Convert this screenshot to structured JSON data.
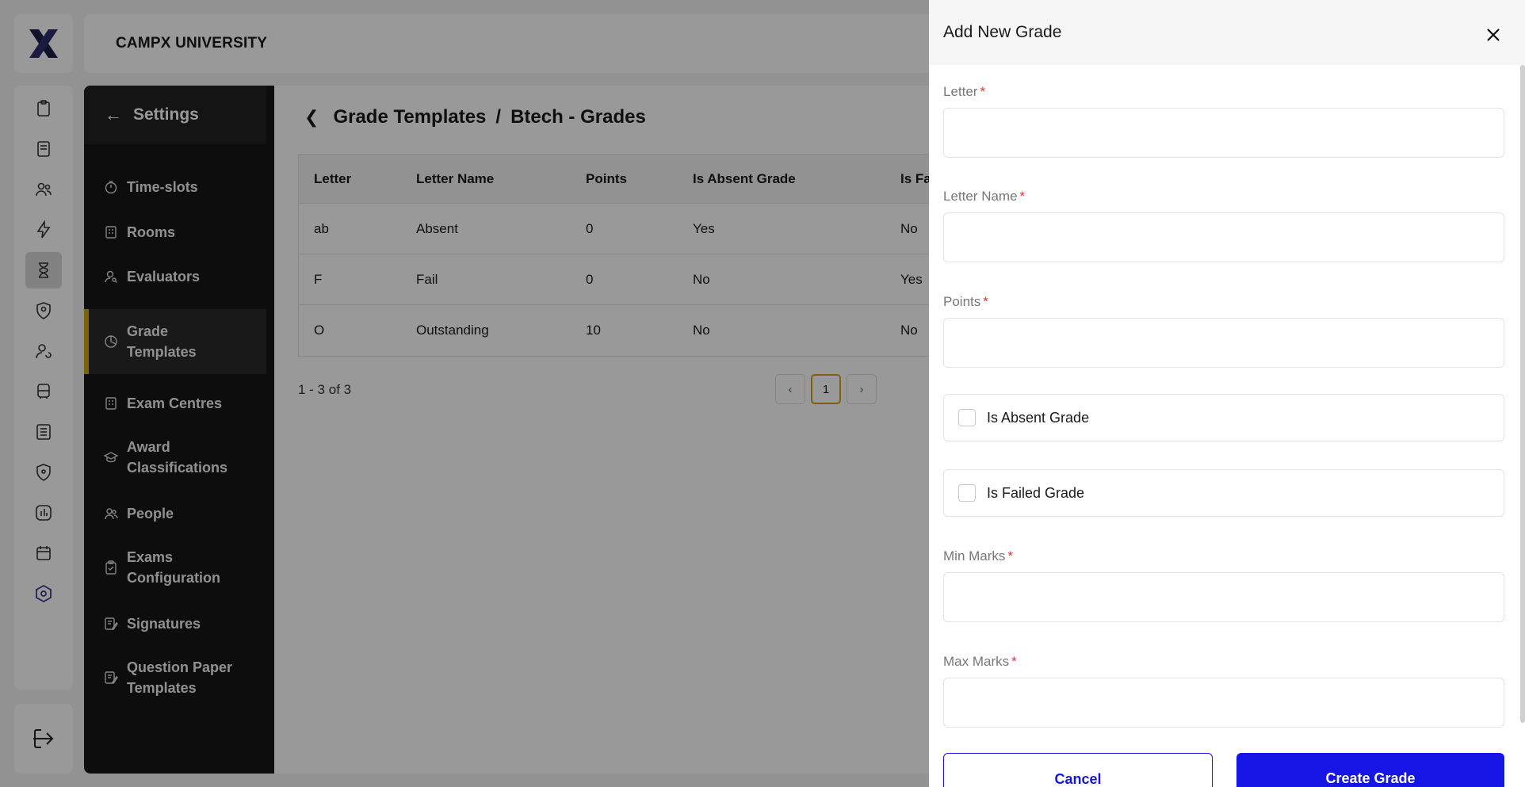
{
  "header": {
    "title": "CAMPX UNIVERSITY"
  },
  "rail": {
    "icons": [
      "clipboard-icon",
      "notebook-icon",
      "users-icon",
      "lightning-icon",
      "hourglass-icon",
      "shield-user-icon",
      "user-refresh-icon",
      "bus-icon",
      "list-icon",
      "location-shield-icon",
      "chart-icon",
      "calendar-icon",
      "settings-hex-icon"
    ],
    "active": "hourglass-icon",
    "logout_icon": "logout-icon"
  },
  "settings": {
    "title": "Settings",
    "items": [
      {
        "label": "Time-slots",
        "icon": "stopwatch-icon"
      },
      {
        "label": "Rooms",
        "icon": "building-icon"
      },
      {
        "label": "Evaluators",
        "icon": "user-search-icon"
      },
      {
        "label": "Grade Templates",
        "icon": "grade-icon",
        "active": true
      },
      {
        "label": "Exam Centres",
        "icon": "building-icon"
      },
      {
        "label": "Award Classifications",
        "icon": "graduation-cap-icon"
      },
      {
        "label": "People",
        "icon": "users-icon"
      },
      {
        "label": "Exams Configuration",
        "icon": "clipboard-check-icon"
      },
      {
        "label": "Signatures",
        "icon": "signature-icon"
      },
      {
        "label": "Question Paper Templates",
        "icon": "signature-icon"
      }
    ]
  },
  "breadcrumb": {
    "parent": "Grade Templates",
    "separator": "/",
    "current": "Btech - Grades"
  },
  "table": {
    "headers": [
      "Letter",
      "Letter Name",
      "Points",
      "Is Absent Grade",
      "Is Fa"
    ],
    "rows": [
      [
        "ab",
        "Absent",
        "0",
        "Yes",
        "No"
      ],
      [
        "F",
        "Fail",
        "0",
        "No",
        "Yes"
      ],
      [
        "O",
        "Outstanding",
        "10",
        "No",
        "No"
      ]
    ]
  },
  "pagination": {
    "summary": "1 - 3 of 3",
    "current_page": "1",
    "prev": "‹",
    "next": "›"
  },
  "drawer": {
    "title": "Add New Grade",
    "fields": {
      "letter": {
        "label": "Letter",
        "value": ""
      },
      "letter_name": {
        "label": "Letter Name",
        "value": ""
      },
      "points": {
        "label": "Points",
        "value": ""
      },
      "min_marks": {
        "label": "Min Marks",
        "value": ""
      },
      "max_marks": {
        "label": "Max Marks",
        "value": ""
      }
    },
    "checkboxes": {
      "is_absent": {
        "label": "Is Absent Grade",
        "checked": false
      },
      "is_failed": {
        "label": "Is Failed Grade",
        "checked": false
      }
    },
    "required_mark": "*",
    "cancel_label": "Cancel",
    "create_label": "Create Grade"
  },
  "colors": {
    "accent": "#1515e6",
    "active_marker": "#d4a017",
    "sidebar_bg": "#171717",
    "required": "#dd3333"
  }
}
